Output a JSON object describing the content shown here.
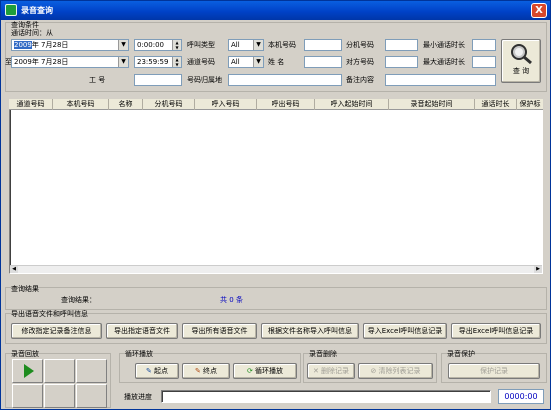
{
  "window": {
    "title": "录音查询",
    "close": "X"
  },
  "query": {
    "group_label": "查询条件",
    "time_label": "通话时间：从",
    "to_label": "至",
    "start_year": "2009",
    "start_date_rest": "年 7月28日",
    "start_time": "0:00:00",
    "end_date": "2009年 7月28日",
    "end_time": "23:59:59",
    "call_type_label": "呼叫类型",
    "call_type_value": "All",
    "channel_label": "通道号码",
    "channel_value": "All",
    "local_no_label": "本机号码",
    "name_label": "姓  名",
    "ext_label": "分机号码",
    "peer_label": "对方号码",
    "min_dur_label": "最小通话时长",
    "max_dur_label": "最大通话时长",
    "worker_label": "工    号",
    "region_label": "号码归属地",
    "remark_label": "备注内容",
    "query_button": "查 询"
  },
  "table": {
    "columns": [
      "通道号码",
      "本机号码",
      "名称",
      "分机号码",
      "呼入号码",
      "呼出号码",
      "呼入起始时间",
      "录音起始时间",
      "通话时长",
      "保护标"
    ]
  },
  "result": {
    "group_label": "查询结果",
    "label": "查询结果：",
    "total_prefix": "共",
    "total": "0",
    "total_suffix": "条"
  },
  "export": {
    "group_label": "导出语音文件和呼叫信息",
    "buttons": [
      "修改指定记录备注信息",
      "导出指定语音文件",
      "导出所有语音文件",
      "根据文件名称导入呼叫信息",
      "导入Excel呼叫信息记录",
      "导出Excel呼叫信息记录"
    ]
  },
  "playback": {
    "group_label": "录音回放",
    "loop_label": "循环播放",
    "start_button": "起点",
    "end_button": "终点",
    "loop_button": "循环播放",
    "progress_label": "播放进度",
    "time": "0000:00"
  },
  "delete": {
    "group_label": "录音删除",
    "delete_button": "删除记录",
    "clear_button": "清除列表记录"
  },
  "protect": {
    "group_label": "录音保护",
    "protect_button": "保护记录"
  },
  "colors": {
    "title_bar": "#0042c8",
    "accent_text": "#0000c0",
    "play_green": "#1e8c1e"
  }
}
